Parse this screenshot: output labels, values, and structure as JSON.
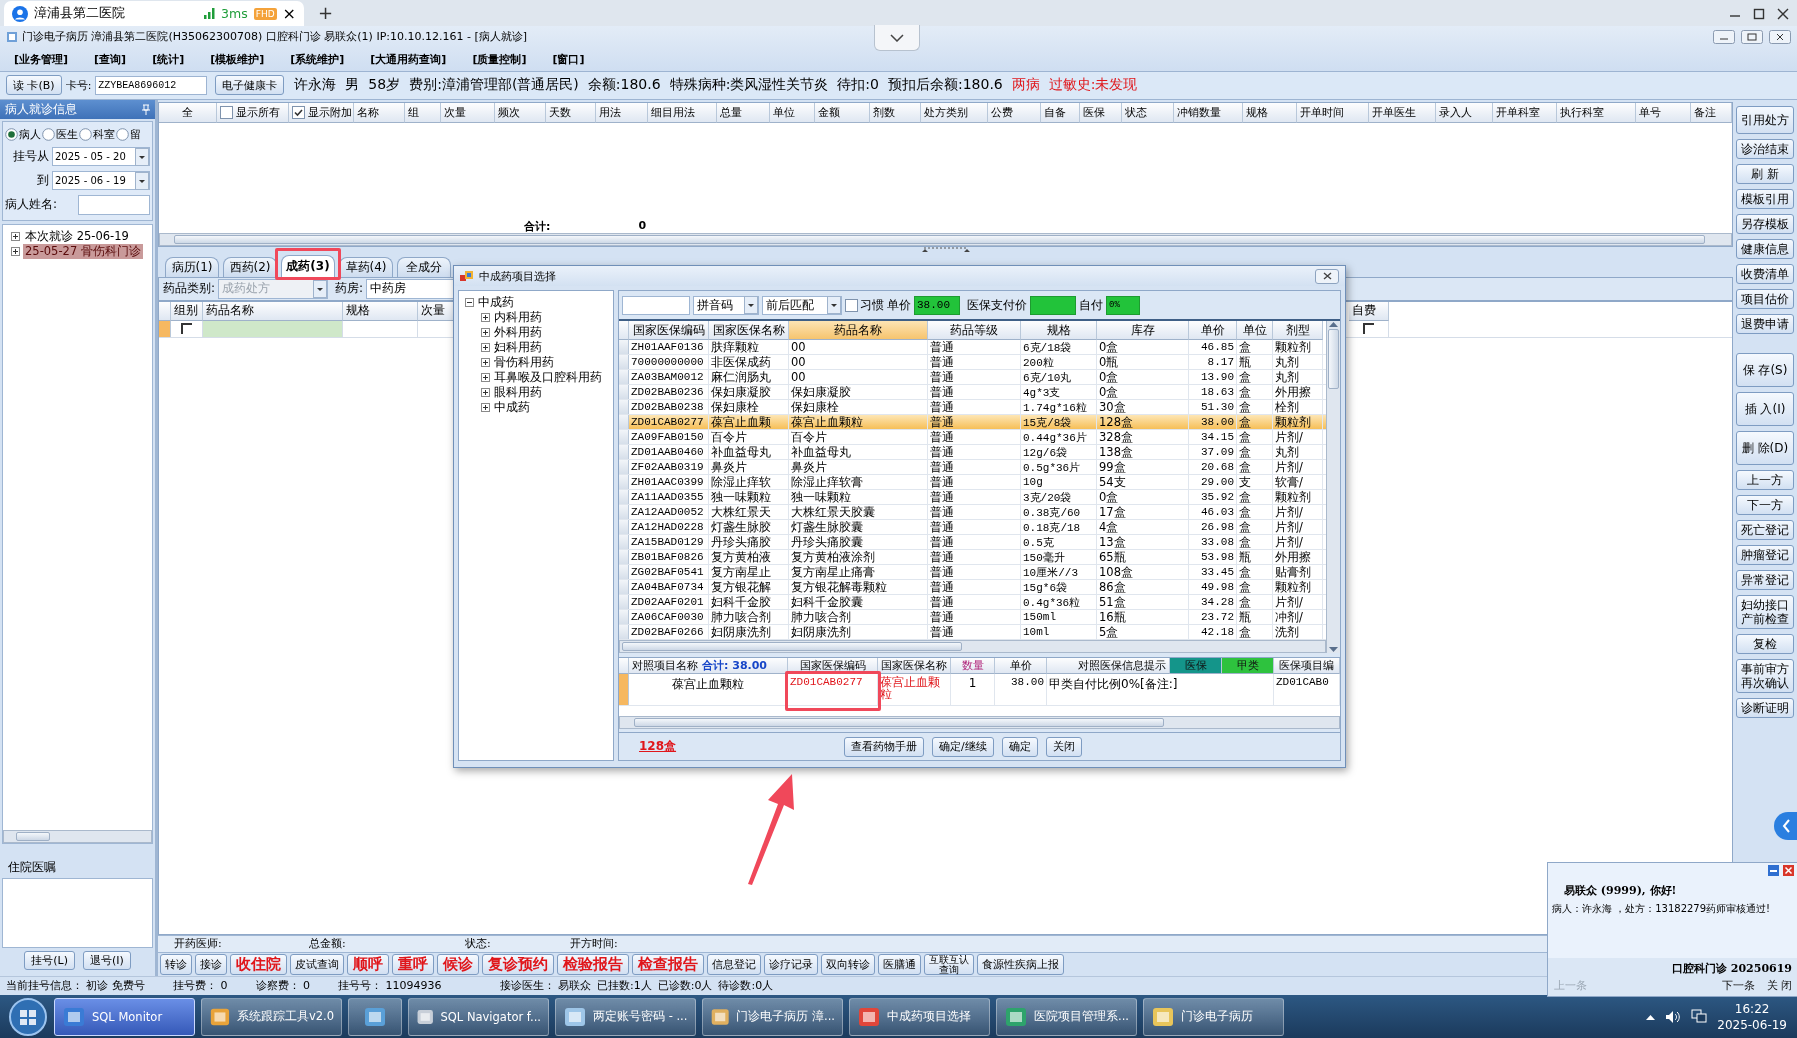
{
  "browser": {
    "tab_title": "漳浦县第二医院",
    "ping": "3ms",
    "badge": "FHD",
    "close_glyph": "×",
    "new_tab_glyph": "+"
  },
  "window": {
    "title": "门诊电子病历  漳浦县第二医院(H35062300708)  口腔科门诊  易联众(1) IP:10.10.12.161 - [病人就诊]"
  },
  "menu": [
    "[业务管理]",
    "[查询]",
    "[统计]",
    "[模板维护]",
    "[系统维护]",
    "[大通用药查询]",
    "[质量控制]",
    "[窗口]"
  ],
  "patient_bar": {
    "read_card": "读 卡(B)",
    "card_label": "卡号:",
    "card_number": "ZZYBEA8696012",
    "health_card": "电子健康卡",
    "info": [
      {
        "text": "许永海",
        "kind": "normal"
      },
      {
        "text": "男",
        "kind": "normal"
      },
      {
        "text": "58岁",
        "kind": "normal"
      },
      {
        "text": "费别:漳浦管理部(普通居民)",
        "kind": "normal"
      },
      {
        "text": "余额:180.6",
        "kind": "normal"
      },
      {
        "text": "特殊病种:类风湿性关节炎",
        "kind": "normal"
      },
      {
        "text": "待扣:0",
        "kind": "normal"
      },
      {
        "text": "预扣后余额:180.6",
        "kind": "normal"
      },
      {
        "text": "两病",
        "kind": "alert"
      },
      {
        "text": "过敏史:未发现",
        "kind": "alert"
      }
    ]
  },
  "left_panel": {
    "title": "病人就诊信息",
    "radios": [
      {
        "label": "病人",
        "selected": true
      },
      {
        "label": "医生",
        "selected": false
      },
      {
        "label": "科室",
        "selected": false
      },
      {
        "label": "留",
        "selected": false
      }
    ],
    "date_from_label": "挂号从",
    "date_from": "2025 - 05 - 20",
    "date_to_label": "到",
    "date_to": "2025 - 06 - 19",
    "name_label": "病人姓名:",
    "visits": [
      {
        "label": "本次就诊  25-06-19",
        "expanded": false,
        "selected": false
      },
      {
        "label": "25-05-27  骨伤科门诊",
        "expanded": false,
        "selected": true
      }
    ],
    "orders_title": "住院医嘱",
    "buttons": [
      "挂号(L)",
      "退号(I)"
    ]
  },
  "main_grid": {
    "select_all": "全",
    "show_all": {
      "label": "显示所有",
      "checked": false
    },
    "show_extra": {
      "label": "显示附加",
      "checked": true
    },
    "columns": [
      "名称",
      "组",
      "次量",
      "频次",
      "天数",
      "用法",
      "细目用法",
      "总量",
      "单位",
      "金额",
      "剂数",
      "处方类别",
      "公费",
      "自备",
      "医保",
      "状态",
      "冲销数量",
      "规格",
      "开单时间",
      "开单医生",
      "录入人",
      "开单科室",
      "执行科室",
      "单号",
      "备注"
    ],
    "total_label": "合计:",
    "total_value": "0"
  },
  "tabs": [
    {
      "label": "病历(1)",
      "selected": false
    },
    {
      "label": "西药(2)",
      "selected": false
    },
    {
      "label": "成药(3)",
      "selected": true
    },
    {
      "label": "草药(4)",
      "selected": false
    },
    {
      "label": "全成分",
      "selected": false
    }
  ],
  "category_bar": {
    "category_label": "药品类别:",
    "category_value": "成药处方",
    "category_disabled": true,
    "pharmacy_label": "药房:",
    "pharmacy_value": "中药房"
  },
  "lower_grid": {
    "columns": [
      "组别",
      "药品名称",
      "规格",
      "次量",
      "自费"
    ],
    "rows": [
      {
        "group_checked": false,
        "self_pay_checked": false
      }
    ]
  },
  "sidebar": {
    "top_buttons": [
      "引用处方",
      "诊治结束",
      "刷 新",
      "模板引用",
      "另存模板",
      "健康信息",
      "收费清单",
      "项目估价",
      "退费申请"
    ],
    "bottom_buttons": [
      "保 存(S)",
      "插 入(I)",
      "删 除(D)",
      "上一方",
      "下一方",
      "死亡登记",
      "肿瘤登记",
      "异常登记",
      "妇幼接口产前检查",
      "复检",
      "事前审方再次确认",
      "诊断证明"
    ]
  },
  "footer": {
    "fields": [
      "开药医师:",
      "总金额:",
      "状态:",
      "开方时间:"
    ],
    "buttons": [
      {
        "label": "转诊",
        "kind": "normal"
      },
      {
        "label": "接诊",
        "kind": "normal"
      },
      {
        "label": "收住院",
        "kind": "alert"
      },
      {
        "label": "皮试查询",
        "kind": "normal"
      },
      {
        "label": "顺呼",
        "kind": "alert"
      },
      {
        "label": "重呼",
        "kind": "alert"
      },
      {
        "label": "候诊",
        "kind": "alert"
      },
      {
        "label": "复诊预约",
        "kind": "alert"
      },
      {
        "label": "检验报告",
        "kind": "alert"
      },
      {
        "label": "检查报告",
        "kind": "alert"
      },
      {
        "label": "信息登记",
        "kind": "normal"
      },
      {
        "label": "诊疗记录",
        "kind": "normal"
      },
      {
        "label": "双向转诊",
        "kind": "normal"
      },
      {
        "label": "医膳通",
        "kind": "normal"
      },
      {
        "label": "互联互认查询",
        "kind": "normal"
      },
      {
        "label": "食源性疾病上报",
        "kind": "normal"
      }
    ]
  },
  "status_line": [
    "当前挂号信息：  初诊 免费号",
    "挂号费：  0",
    "诊察费：  0",
    "挂号号：  11094936",
    "接诊医生：  易联众",
    "已挂数:1人",
    "已诊数:0人",
    "待诊数:0人"
  ],
  "taskbar": {
    "items": [
      {
        "label": "SQL Monitor",
        "selected": true
      },
      {
        "label": "系统跟踪工具v2.0",
        "selected": false
      },
      {
        "selected": false
      },
      {
        "label": "SQL Navigator f...",
        "selected": false
      },
      {
        "label": "两定账号密码 - ...",
        "selected": false
      },
      {
        "label": "门诊电子病历  漳...",
        "selected": false
      },
      {
        "label": "中成药项目选择",
        "selected": false
      },
      {
        "label": "医院项目管理系...",
        "selected": false
      },
      {
        "label": "门诊电子病历",
        "selected": false
      }
    ],
    "time": "16:22",
    "date": "2025-06-19"
  },
  "dialog": {
    "title": "中成药项目选择",
    "tree": {
      "label": "中成药",
      "expanded": true,
      "children": [
        {
          "label": "内科用药",
          "expanded": false
        },
        {
          "label": "外科用药",
          "expanded": false
        },
        {
          "label": "妇科用药",
          "expanded": false
        },
        {
          "label": "骨伤科用药",
          "expanded": false
        },
        {
          "label": "耳鼻喉及口腔科用药",
          "expanded": false
        },
        {
          "label": "眼科用药",
          "expanded": false
        },
        {
          "label": "中成药",
          "expanded": false
        }
      ]
    },
    "code_type": "拼音码",
    "match_mode": "前后匹配",
    "habit": {
      "label": "习惯",
      "checked": false
    },
    "price_label": "单价",
    "price_value": "38.00",
    "ins_price_label": "医保支付价",
    "self_pay_label": "自付",
    "self_pay_value": "0%",
    "columns": [
      {
        "label": "国家医保编码",
        "sorted": false
      },
      {
        "label": "国家医保名称",
        "sorted": false
      },
      {
        "label": "药品名称",
        "sorted": true
      },
      {
        "label": "药品等级",
        "sorted": false
      },
      {
        "label": "规格",
        "sorted": false
      },
      {
        "label": "库存",
        "sorted": false
      },
      {
        "label": "单价",
        "sorted": false
      },
      {
        "label": "单位",
        "sorted": false
      },
      {
        "label": "剂型",
        "sorted": false
      }
    ],
    "rows": [
      {
        "code": "ZH01AAF0136",
        "ins_name": "肤痒颗粒",
        "name": "00",
        "grade": "普通",
        "spec": "6克/18袋",
        "stock": "0盒",
        "price": "46.85",
        "unit": "盒",
        "form": "颗粒剂",
        "selected": false
      },
      {
        "code": "70000000000",
        "ins_name": "非医保成药",
        "name": "00",
        "grade": "普通",
        "spec": "200粒",
        "stock": "0瓶",
        "price": "8.17",
        "unit": "瓶",
        "form": "丸剂",
        "selected": false
      },
      {
        "code": "ZA03BAM0012",
        "ins_name": "麻仁润肠丸",
        "name": "00",
        "grade": "普通",
        "spec": "6克/10丸",
        "stock": "0盒",
        "price": "13.90",
        "unit": "盒",
        "form": "丸剂",
        "selected": false
      },
      {
        "code": "ZD02BAB0236",
        "ins_name": "保妇康凝胶",
        "name": "保妇康凝胶",
        "grade": "普通",
        "spec": "4g*3支",
        "stock": "0盒",
        "price": "18.63",
        "unit": "盒",
        "form": "外用擦",
        "selected": false
      },
      {
        "code": "ZD02BAB0238",
        "ins_name": "保妇康栓",
        "name": "保妇康栓",
        "grade": "普通",
        "spec": "1.74g*16粒",
        "stock": "30盒",
        "price": "51.30",
        "unit": "盒",
        "form": "栓剂",
        "selected": false
      },
      {
        "code": "ZD01CAB0277",
        "ins_name": "葆宫止血颗",
        "name": "葆宫止血颗粒",
        "grade": "普通",
        "spec": "15克/8袋",
        "stock": "128盒",
        "price": "38.00",
        "unit": "盒",
        "form": "颗粒剂",
        "selected": true
      },
      {
        "code": "ZA09FAB0150",
        "ins_name": "百令片",
        "name": "百令片",
        "grade": "普通",
        "spec": "0.44g*36片",
        "stock": "328盒",
        "price": "34.15",
        "unit": "盒",
        "form": "片剂/",
        "selected": false
      },
      {
        "code": "ZD01AAB0460",
        "ins_name": "补血益母丸",
        "name": "补血益母丸",
        "grade": "普通",
        "spec": "12g/6袋",
        "stock": "138盒",
        "price": "37.09",
        "unit": "盒",
        "form": "丸剂",
        "selected": false
      },
      {
        "code": "ZF02AAB0319",
        "ins_name": "鼻炎片",
        "name": "鼻炎片",
        "grade": "普通",
        "spec": "0.5g*36片",
        "stock": "99盒",
        "price": "20.68",
        "unit": "盒",
        "form": "片剂/",
        "selected": false
      },
      {
        "code": "ZH01AAC0399",
        "ins_name": "除湿止痒软",
        "name": "除湿止痒软膏",
        "grade": "普通",
        "spec": "10g",
        "stock": "54支",
        "price": "29.00",
        "unit": "支",
        "form": "软膏/",
        "selected": false
      },
      {
        "code": "ZA11AAD0355",
        "ins_name": "独一味颗粒",
        "name": "独一味颗粒",
        "grade": "普通",
        "spec": "3克/20袋",
        "stock": "0盒",
        "price": "35.92",
        "unit": "盒",
        "form": "颗粒剂",
        "selected": false
      },
      {
        "code": "ZA12AAD0052",
        "ins_name": "大株红景天",
        "name": "大株红景天胶囊",
        "grade": "普通",
        "spec": "0.38克/60",
        "stock": "17盒",
        "price": "46.03",
        "unit": "盒",
        "form": "片剂/",
        "selected": false
      },
      {
        "code": "ZA12HAD0228",
        "ins_name": "灯盏生脉胶",
        "name": "灯盏生脉胶囊",
        "grade": "普通",
        "spec": "0.18克/18",
        "stock": "4盒",
        "price": "26.98",
        "unit": "盒",
        "form": "片剂/",
        "selected": false
      },
      {
        "code": "ZA15BAD0129",
        "ins_name": "丹珍头痛胶",
        "name": "丹珍头痛胶囊",
        "grade": "普通",
        "spec": "0.5克",
        "stock": "13盒",
        "price": "33.08",
        "unit": "盒",
        "form": "片剂/",
        "selected": false
      },
      {
        "code": "ZB01BAF0826",
        "ins_name": "复方黄柏液",
        "name": "复方黄柏液涂剂",
        "grade": "普通",
        "spec": "150毫升",
        "stock": "65瓶",
        "price": "53.98",
        "unit": "瓶",
        "form": "外用擦",
        "selected": false
      },
      {
        "code": "ZG02BAF0541",
        "ins_name": "复方南星止",
        "name": "复方南星止痛膏",
        "grade": "普通",
        "spec": "10厘米//3",
        "stock": "108盒",
        "price": "33.45",
        "unit": "盒",
        "form": "贴膏剂",
        "selected": false
      },
      {
        "code": "ZA04BAF0734",
        "ins_name": "复方银花解",
        "name": "复方银花解毒颗粒",
        "grade": "普通",
        "spec": "15g*6袋",
        "stock": "86盒",
        "price": "49.98",
        "unit": "盒",
        "form": "颗粒剂",
        "selected": false
      },
      {
        "code": "ZD02AAF0201",
        "ins_name": "妇科千金胶",
        "name": "妇科千金胶囊",
        "grade": "普通",
        "spec": "0.4g*36粒",
        "stock": "51盒",
        "price": "34.28",
        "unit": "盒",
        "form": "片剂/",
        "selected": false
      },
      {
        "code": "ZA06CAF0030",
        "ins_name": "肺力咳合剂",
        "name": "肺力咳合剂",
        "grade": "普通",
        "spec": "150ml",
        "stock": "16瓶",
        "price": "23.72",
        "unit": "瓶",
        "form": "冲剂/",
        "selected": false
      },
      {
        "code": "ZD02BAF0266",
        "ins_name": "妇阴康洗剂",
        "name": "妇阴康洗剂",
        "grade": "普通",
        "spec": "10ml",
        "stock": "5盒",
        "price": "42.18",
        "unit": "盒",
        "form": "洗剂",
        "selected": false
      }
    ],
    "selection": {
      "columns": [
        "对照项目名称",
        "国家医保编码",
        "国家医保名称",
        "数量",
        "单价",
        "对照医保信息提示",
        "医保项目编"
      ],
      "total": "合计: 38.00",
      "badges": [
        {
          "label": "医保",
          "color": "#14958a"
        },
        {
          "label": "甲类",
          "color": "#2ec23e"
        }
      ],
      "rows": [
        {
          "item": "葆宫止血颗粒",
          "code": "ZD01CAB0277",
          "ins_name": "葆宫止血颗粒",
          "qty": "1",
          "price": "38.00",
          "tip": "甲类自付比例0%[备注:]",
          "item_code": "ZD01CAB0"
        }
      ]
    },
    "stock": "128盒",
    "buttons": [
      "查看药物手册",
      "确定/继续",
      "确定",
      "关闭"
    ]
  },
  "notice": {
    "greeting": "易联众 (9999), 你好!",
    "message": "病人：许永海 ，处方：13182279药师审核通过!",
    "signature": "口腔科门诊  20250619",
    "links": [
      {
        "label": "上一条",
        "disabled": true
      },
      {
        "label": "下一条",
        "disabled": false
      },
      {
        "label": "关 闭",
        "disabled": false
      }
    ]
  }
}
